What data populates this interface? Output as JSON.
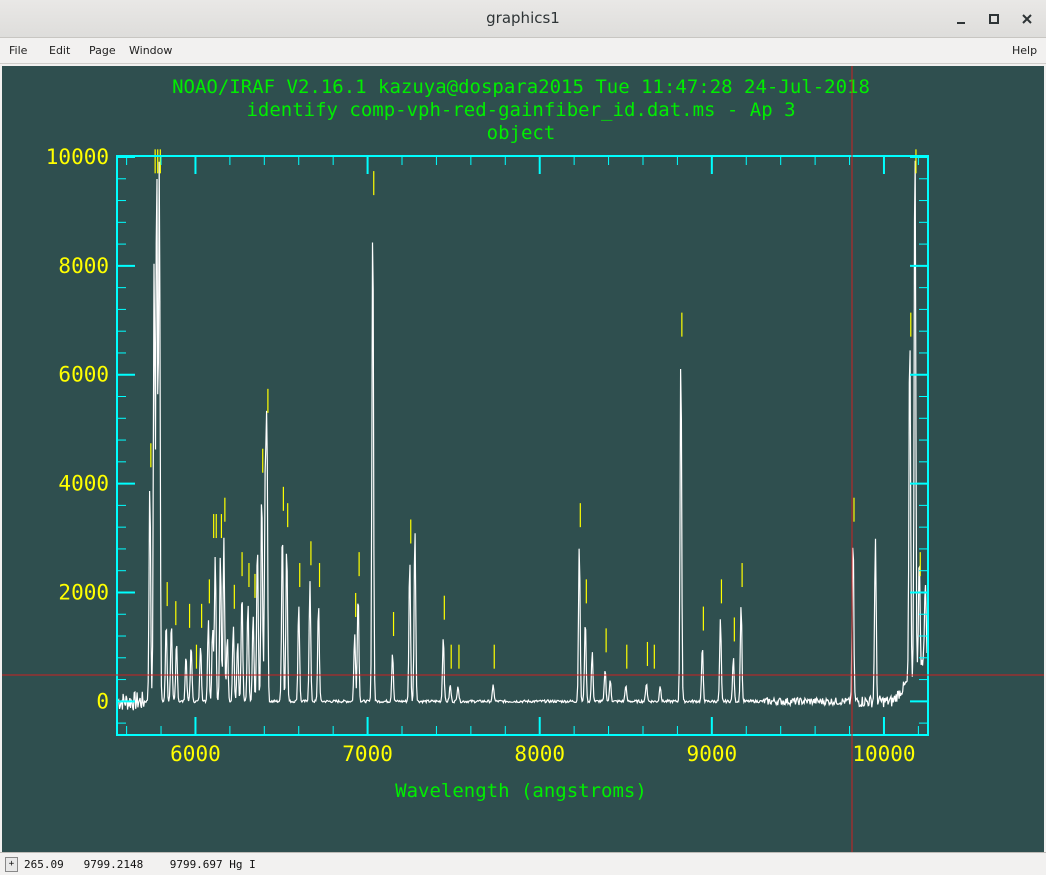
{
  "window": {
    "title": "graphics1"
  },
  "menu": {
    "file": "File",
    "edit": "Edit",
    "page": "Page",
    "window": "Window",
    "help": "Help"
  },
  "plot": {
    "header_line1": "NOAO/IRAF V2.16.1 kazuya@dospara2015 Tue 11:47:28 24-Jul-2018",
    "header_line2": "identify comp-vph-red-gainfiber_id.dat.ms - Ap 3",
    "header_line3": "object",
    "xlabel": "Wavelength (angstroms)",
    "colors": {
      "background": "#2f4f4f",
      "frame": "#00ffff",
      "text": "#00ee00",
      "ticklabels": "#ffff00",
      "spectrum": "#ffffff",
      "marks": "#ffff00",
      "cursor": "#cc2222"
    },
    "cursor": {
      "wavelength": 9799.2148,
      "level": 500
    }
  },
  "chart_data": {
    "type": "line",
    "title": "identify comp-vph-red-gainfiber_id.dat.ms - Ap 3",
    "subtitle": "object",
    "xlabel": "Wavelength (angstroms)",
    "ylabel": "",
    "xlim": [
      5550,
      10250
    ],
    "ylim": [
      -600,
      10000
    ],
    "xticks": [
      6000,
      7000,
      8000,
      9000,
      10000
    ],
    "xtick_labels": [
      "6000",
      "7000",
      "8000",
      "9000",
      "10000"
    ],
    "yticks": [
      0,
      2000,
      4000,
      6000,
      8000,
      10000
    ],
    "ytick_labels": [
      "0",
      "2000",
      "4000",
      "6000",
      "8000",
      "10000"
    ],
    "grid": false,
    "series": [
      {
        "lines": [
          [
            5735,
            4000
          ],
          [
            5760,
            8100
          ],
          [
            5775,
            10000
          ],
          [
            5790,
            10000
          ],
          [
            5830,
            1450
          ],
          [
            5860,
            1450
          ],
          [
            5890,
            1100
          ],
          [
            5945,
            850
          ],
          [
            5975,
            1050
          ],
          [
            6030,
            1050
          ],
          [
            6075,
            1500
          ],
          [
            6100,
            1350
          ],
          [
            6115,
            2700
          ],
          [
            6145,
            2700
          ],
          [
            6165,
            3000
          ],
          [
            6185,
            1200
          ],
          [
            6220,
            1400
          ],
          [
            6245,
            1100
          ],
          [
            6270,
            2000
          ],
          [
            6305,
            1800
          ],
          [
            6335,
            1600
          ],
          [
            6360,
            2900
          ],
          [
            6385,
            3900
          ],
          [
            6405,
            3900
          ],
          [
            6415,
            5000
          ],
          [
            6505,
            3200
          ],
          [
            6530,
            2900
          ],
          [
            6600,
            1800
          ],
          [
            6665,
            2200
          ],
          [
            6715,
            1800
          ],
          [
            6925,
            1250
          ],
          [
            6945,
            2000
          ],
          [
            7030,
            9000
          ],
          [
            7145,
            900
          ],
          [
            7245,
            2600
          ],
          [
            7275,
            3200
          ],
          [
            7440,
            1200
          ],
          [
            7480,
            300
          ],
          [
            7525,
            300
          ],
          [
            7730,
            300
          ],
          [
            8230,
            2900
          ],
          [
            8265,
            1500
          ],
          [
            8305,
            900
          ],
          [
            8380,
            600
          ],
          [
            8410,
            400
          ],
          [
            8500,
            300
          ],
          [
            8620,
            350
          ],
          [
            8700,
            300
          ],
          [
            8820,
            6400
          ],
          [
            8945,
            1000
          ],
          [
            9050,
            1500
          ],
          [
            9125,
            800
          ],
          [
            9170,
            1800
          ],
          [
            9820,
            3000
          ],
          [
            9950,
            3000
          ],
          [
            10150,
            6400
          ],
          [
            10180,
            10000
          ],
          [
            10205,
            2000
          ],
          [
            10240,
            1500
          ]
        ]
      }
    ],
    "identified_lines": [
      5735,
      5760,
      5775,
      5790,
      5830,
      5880,
      5960,
      6000,
      6030,
      6075,
      6100,
      6115,
      6145,
      6165,
      6220,
      6265,
      6305,
      6340,
      6385,
      6415,
      6505,
      6530,
      6600,
      6665,
      6715,
      6925,
      6945,
      7030,
      7145,
      7245,
      7440,
      7480,
      7525,
      7730,
      8230,
      8265,
      8380,
      8500,
      8620,
      8660,
      8820,
      8945,
      9050,
      9125,
      9170,
      9820,
      10150,
      10180,
      10205
    ]
  },
  "status": {
    "button": "+",
    "text": "265.09   9799.2148    9799.697 Hg I"
  }
}
